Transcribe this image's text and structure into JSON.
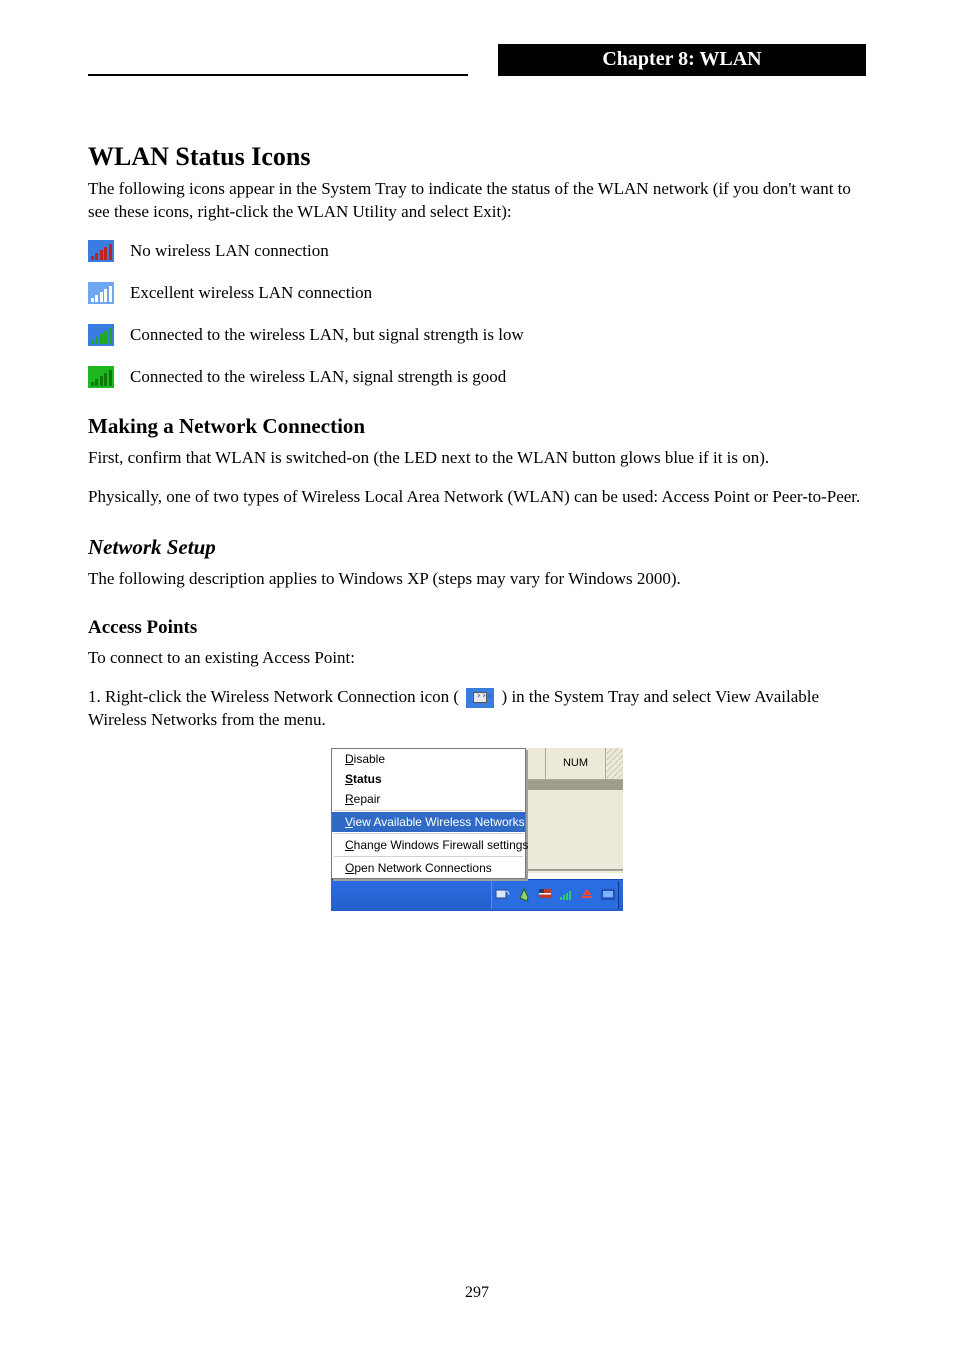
{
  "header": {
    "chapter_title": "Chapter 8: WLAN"
  },
  "sections": {
    "heading1": "WLAN Status Icons",
    "para1": "The following icons appear in the System Tray to indicate the status of the WLAN network (if you don't want to see these icons, right-click the WLAN Utility and select Exit):",
    "signal_icons": [
      {
        "text": "No wireless LAN connection",
        "style": "red"
      },
      {
        "text": "Excellent wireless LAN connection",
        "style": "blue"
      },
      {
        "text": "Connected to the wireless LAN, but signal strength is low",
        "style": "green"
      },
      {
        "text": "Connected to the wireless LAN, signal strength is good",
        "style": "greenfull"
      }
    ],
    "heading2": "Making a Network Connection",
    "para2a": "First, confirm that WLAN is switched-on (the LED next to the WLAN button glows blue if it is on).",
    "para2b": "Physically, one of two types of Wireless Local Area Network (WLAN) can be used: Access Point or Peer-to-Peer.",
    "heading2_1": "Network Setup",
    "para3": "The following description applies to Windows XP (steps may vary for Windows 2000).",
    "heading3": "Access Points",
    "intro4": "To connect to an existing Access Point:",
    "step1": "Right-click the Wireless Network Connection icon (",
    "step1_tail": ") in the System Tray and select View Available Wireless Networks from the menu.",
    "ol_num": "1."
  },
  "context_menu": {
    "items": [
      {
        "label_pre": "D",
        "label_rest": "isable",
        "bold": false
      },
      {
        "label_pre": "S",
        "label_rest": "tatus",
        "bold": true
      },
      {
        "label_pre": "R",
        "label_rest": "epair",
        "bold": false
      }
    ],
    "selected": {
      "label_pre": "V",
      "label_rest": "iew Available Wireless Networks"
    },
    "group2": [
      {
        "label_pre": "C",
        "label_rest": "hange Windows Firewall settings"
      }
    ],
    "group3": [
      {
        "label_pre": "O",
        "label_rest": "pen Network Connections"
      }
    ]
  },
  "statusbar": {
    "num_label": "NUM"
  },
  "page": {
    "number": "297"
  }
}
